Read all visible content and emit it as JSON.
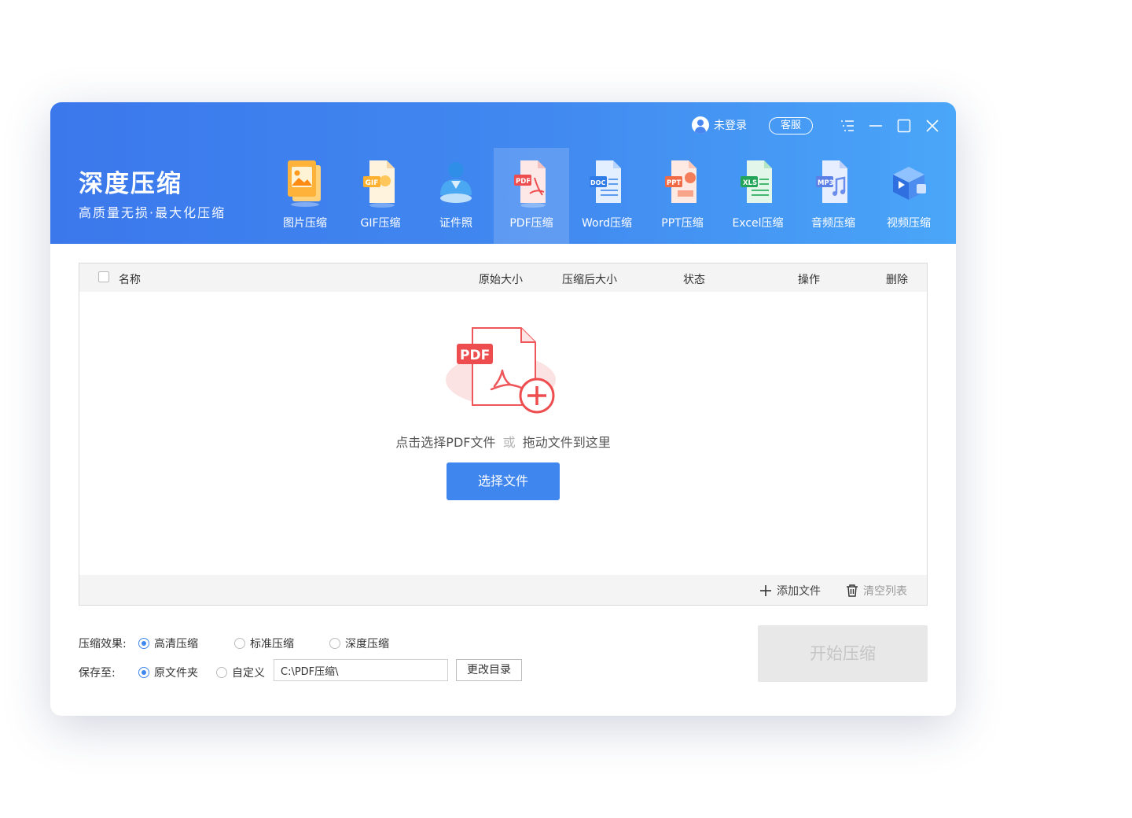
{
  "app": {
    "title": "深度压缩",
    "subtitle": "高质量无损·最大化压缩"
  },
  "topbar": {
    "login_label": "未登录",
    "service_label": "客服"
  },
  "tools": [
    {
      "label": "图片压缩",
      "icon": "image-file-icon"
    },
    {
      "label": "GIF压缩",
      "icon": "gif-file-icon"
    },
    {
      "label": "证件照",
      "icon": "id-photo-icon"
    },
    {
      "label": "PDF压缩",
      "icon": "pdf-file-icon",
      "active": true
    },
    {
      "label": "Word压缩",
      "icon": "doc-file-icon"
    },
    {
      "label": "PPT压缩",
      "icon": "ppt-file-icon"
    },
    {
      "label": "Excel压缩",
      "icon": "xls-file-icon"
    },
    {
      "label": "音频压缩",
      "icon": "mp3-file-icon"
    },
    {
      "label": "视频压缩",
      "icon": "video-file-icon"
    }
  ],
  "table": {
    "columns": [
      "名称",
      "原始大小",
      "压缩后大小",
      "状态",
      "操作",
      "删除"
    ]
  },
  "dropzone": {
    "badge": "PDF",
    "text_main": "点击选择PDF文件",
    "text_or": "或",
    "text_drag": "拖动文件到这里",
    "button": "选择文件"
  },
  "footer": {
    "add_file": "添加文件",
    "clear_list": "清空列表"
  },
  "options": {
    "effect_label": "压缩效果:",
    "effects": [
      "高清压缩",
      "标准压缩",
      "深度压缩"
    ],
    "effect_selected": "高清压缩",
    "save_label": "保存至:",
    "save_options": [
      "原文件夹",
      "自定义"
    ],
    "save_selected": "原文件夹",
    "path_value": "C:\\PDF压缩\\",
    "change_dir": "更改目录"
  },
  "start_button": "开始压缩",
  "colors": {
    "accent": "#3f86ef",
    "header_start": "#3b78ec",
    "header_end": "#4aa6f8",
    "pdf_red": "#e6474b",
    "disabled_bg": "#e8e8e8"
  }
}
